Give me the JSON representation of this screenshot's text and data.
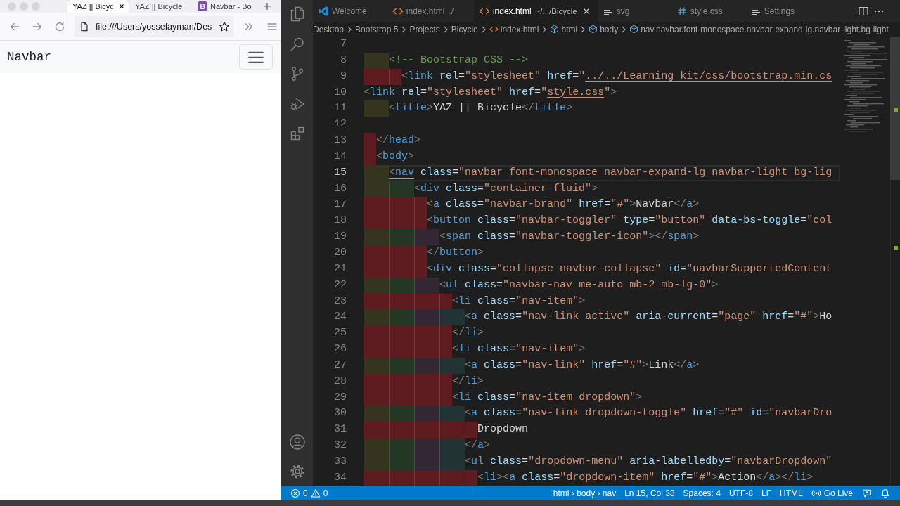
{
  "browser": {
    "tabs": [
      {
        "title": "YAZ || Bicyc",
        "selected": true
      },
      {
        "title": "YAZ || Bicycle",
        "selected": false
      },
      {
        "title": "Navbar - Bo",
        "favicon": "B",
        "selected": false
      }
    ],
    "address": "file:///Users/yossefayman/Des",
    "page": {
      "brand": "Navbar"
    }
  },
  "editor_tabs": [
    {
      "label": "Welcome",
      "kind": "welcome",
      "selected": false
    },
    {
      "label": "index.html",
      "description": "./",
      "kind": "html",
      "selected": false
    },
    {
      "label": "index.html",
      "description": "~/.../Bicycle",
      "kind": "html",
      "selected": true
    },
    {
      "label": "svg",
      "kind": "preview",
      "selected": false
    },
    {
      "label": "style.css",
      "kind": "css",
      "selected": false
    },
    {
      "label": "Settings",
      "kind": "preview",
      "selected": false
    }
  ],
  "breadcrumbs": [
    {
      "label": "Desktop",
      "kind": "folder"
    },
    {
      "label": "Bootstrap 5",
      "kind": "folder"
    },
    {
      "label": "Projects",
      "kind": "folder"
    },
    {
      "label": "Bicycle",
      "kind": "folder"
    },
    {
      "label": "index.html",
      "kind": "file"
    },
    {
      "label": "html",
      "kind": "element"
    },
    {
      "label": "body",
      "kind": "element"
    },
    {
      "label": "nav.navbar.font-monospace.navbar-expand-lg.navbar-light.bg-light",
      "kind": "element"
    }
  ],
  "editor": {
    "lines": [
      {
        "number": "7",
        "current": false
      },
      {
        "number": "8",
        "current": false,
        "indent_error": false,
        "code": [
          {
            "kind": "comment",
            "text": "    <!-- Bootstrap CSS -->"
          }
        ]
      },
      {
        "number": "9",
        "current": false,
        "indent_error": true,
        "code": [
          {
            "kind": "punct",
            "text": "      <"
          },
          {
            "kind": "tag",
            "text": "link"
          },
          {
            "kind": "attr",
            "text": " rel"
          },
          {
            "kind": "eq",
            "text": "="
          },
          {
            "kind": "str",
            "text": "\"stylesheet\""
          },
          {
            "kind": "attr",
            "text": " href"
          },
          {
            "kind": "eq",
            "text": "="
          },
          {
            "kind": "str",
            "text": "\""
          },
          {
            "kind": "link",
            "text": "../../Learning kit/css/bootstrap.min.cs"
          }
        ]
      },
      {
        "number": "10",
        "current": false,
        "code": [
          {
            "kind": "punct",
            "text": "<"
          },
          {
            "kind": "tag",
            "text": "link"
          },
          {
            "kind": "attr",
            "text": " rel"
          },
          {
            "kind": "eq",
            "text": "="
          },
          {
            "kind": "str",
            "text": "\"stylesheet\""
          },
          {
            "kind": "attr",
            "text": " href"
          },
          {
            "kind": "eq",
            "text": "="
          },
          {
            "kind": "str",
            "text": "\""
          },
          {
            "kind": "link",
            "text": "style.css"
          },
          {
            "kind": "str",
            "text": "\""
          },
          {
            "kind": "punct",
            "text": ">"
          }
        ]
      },
      {
        "number": "11",
        "current": false,
        "indent_error": false,
        "code": [
          {
            "kind": "punct",
            "text": "    <"
          },
          {
            "kind": "tag",
            "text": "title"
          },
          {
            "kind": "punct",
            "text": ">"
          },
          {
            "kind": "text",
            "text": "YAZ || Bicycle"
          },
          {
            "kind": "punct",
            "text": "</"
          },
          {
            "kind": "tag",
            "text": "title"
          },
          {
            "kind": "punct",
            "text": ">"
          }
        ]
      },
      {
        "number": "12",
        "current": false
      },
      {
        "number": "13",
        "current": false,
        "indent_error": true,
        "code": [
          {
            "kind": "punct",
            "text": "  </"
          },
          {
            "kind": "tag",
            "text": "head"
          },
          {
            "kind": "punct",
            "text": ">"
          }
        ]
      },
      {
        "number": "14",
        "current": false,
        "indent_error": true,
        "code": [
          {
            "kind": "punct",
            "text": "  <"
          },
          {
            "kind": "tag",
            "text": "body"
          },
          {
            "kind": "punct",
            "text": ">"
          }
        ]
      },
      {
        "number": "15",
        "current": true,
        "indent_error": false,
        "code": [
          {
            "kind": "matchpunct",
            "text": "    <"
          },
          {
            "kind": "matchtag",
            "text": "nav"
          },
          {
            "kind": "attr",
            "text": " class"
          },
          {
            "kind": "eq",
            "text": "="
          },
          {
            "kind": "str",
            "text": "\"navbar font-monospace navbar-expand-lg navbar-light bg-lig"
          }
        ]
      },
      {
        "number": "16",
        "current": false,
        "indent_error": false,
        "code": [
          {
            "kind": "punct",
            "text": "        <"
          },
          {
            "kind": "tag",
            "text": "div"
          },
          {
            "kind": "attr",
            "text": " class"
          },
          {
            "kind": "eq",
            "text": "="
          },
          {
            "kind": "str",
            "text": "\"container-fluid\""
          },
          {
            "kind": "punct",
            "text": ">"
          }
        ]
      },
      {
        "number": "17",
        "current": false,
        "indent_error": true,
        "code": [
          {
            "kind": "punct",
            "text": "          <"
          },
          {
            "kind": "tag",
            "text": "a"
          },
          {
            "kind": "attr",
            "text": " class"
          },
          {
            "kind": "eq",
            "text": "="
          },
          {
            "kind": "str",
            "text": "\"navbar-brand\""
          },
          {
            "kind": "attr",
            "text": " href"
          },
          {
            "kind": "eq",
            "text": "="
          },
          {
            "kind": "str",
            "text": "\"#\""
          },
          {
            "kind": "punct",
            "text": ">"
          },
          {
            "kind": "text",
            "text": "Navbar"
          },
          {
            "kind": "punct",
            "text": "</"
          },
          {
            "kind": "tag",
            "text": "a"
          },
          {
            "kind": "punct",
            "text": ">"
          }
        ]
      },
      {
        "number": "18",
        "current": false,
        "indent_error": true,
        "code": [
          {
            "kind": "punct",
            "text": "          <"
          },
          {
            "kind": "tag",
            "text": "button"
          },
          {
            "kind": "attr",
            "text": " class"
          },
          {
            "kind": "eq",
            "text": "="
          },
          {
            "kind": "str",
            "text": "\"navbar-toggler\""
          },
          {
            "kind": "attr",
            "text": " type"
          },
          {
            "kind": "eq",
            "text": "="
          },
          {
            "kind": "str",
            "text": "\"button\""
          },
          {
            "kind": "attr",
            "text": " data-bs-toggle"
          },
          {
            "kind": "eq",
            "text": "="
          },
          {
            "kind": "str",
            "text": "\"col"
          }
        ]
      },
      {
        "number": "19",
        "current": false,
        "indent_error": false,
        "code": [
          {
            "kind": "punct",
            "text": "            <"
          },
          {
            "kind": "tag",
            "text": "span"
          },
          {
            "kind": "attr",
            "text": " class"
          },
          {
            "kind": "eq",
            "text": "="
          },
          {
            "kind": "str",
            "text": "\"navbar-toggler-icon\""
          },
          {
            "kind": "punct",
            "text": "></"
          },
          {
            "kind": "tag",
            "text": "span"
          },
          {
            "kind": "punct",
            "text": ">"
          }
        ]
      },
      {
        "number": "20",
        "current": false,
        "indent_error": true,
        "code": [
          {
            "kind": "punct",
            "text": "          </"
          },
          {
            "kind": "tag",
            "text": "button"
          },
          {
            "kind": "punct",
            "text": ">"
          }
        ]
      },
      {
        "number": "21",
        "current": false,
        "indent_error": true,
        "code": [
          {
            "kind": "punct",
            "text": "          <"
          },
          {
            "kind": "tag",
            "text": "div"
          },
          {
            "kind": "attr",
            "text": " class"
          },
          {
            "kind": "eq",
            "text": "="
          },
          {
            "kind": "str",
            "text": "\"collapse navbar-collapse\""
          },
          {
            "kind": "attr",
            "text": " id"
          },
          {
            "kind": "eq",
            "text": "="
          },
          {
            "kind": "str",
            "text": "\"navbarSupportedContent"
          }
        ]
      },
      {
        "number": "22",
        "current": false,
        "indent_error": false,
        "code": [
          {
            "kind": "punct",
            "text": "            <"
          },
          {
            "kind": "tag",
            "text": "ul"
          },
          {
            "kind": "attr",
            "text": " class"
          },
          {
            "kind": "eq",
            "text": "="
          },
          {
            "kind": "str",
            "text": "\"navbar-nav me-auto mb-2 mb-lg-0\""
          },
          {
            "kind": "punct",
            "text": ">"
          }
        ]
      },
      {
        "number": "23",
        "current": false,
        "indent_error": true,
        "code": [
          {
            "kind": "punct",
            "text": "              <"
          },
          {
            "kind": "tag",
            "text": "li"
          },
          {
            "kind": "attr",
            "text": " class"
          },
          {
            "kind": "eq",
            "text": "="
          },
          {
            "kind": "str",
            "text": "\"nav-item\""
          },
          {
            "kind": "punct",
            "text": ">"
          }
        ]
      },
      {
        "number": "24",
        "current": false,
        "indent_error": false,
        "code": [
          {
            "kind": "punct",
            "text": "                <"
          },
          {
            "kind": "tag",
            "text": "a"
          },
          {
            "kind": "attr",
            "text": " class"
          },
          {
            "kind": "eq",
            "text": "="
          },
          {
            "kind": "str",
            "text": "\"nav-link active\""
          },
          {
            "kind": "attr",
            "text": " aria-current"
          },
          {
            "kind": "eq",
            "text": "="
          },
          {
            "kind": "str",
            "text": "\"page\""
          },
          {
            "kind": "attr",
            "text": " href"
          },
          {
            "kind": "eq",
            "text": "="
          },
          {
            "kind": "str",
            "text": "\"#\""
          },
          {
            "kind": "punct",
            "text": ">"
          },
          {
            "kind": "text",
            "text": "Ho"
          }
        ]
      },
      {
        "number": "25",
        "current": false,
        "indent_error": true,
        "code": [
          {
            "kind": "punct",
            "text": "              </"
          },
          {
            "kind": "tag",
            "text": "li"
          },
          {
            "kind": "punct",
            "text": ">"
          }
        ]
      },
      {
        "number": "26",
        "current": false,
        "indent_error": true,
        "code": [
          {
            "kind": "punct",
            "text": "              <"
          },
          {
            "kind": "tag",
            "text": "li"
          },
          {
            "kind": "attr",
            "text": " class"
          },
          {
            "kind": "eq",
            "text": "="
          },
          {
            "kind": "str",
            "text": "\"nav-item\""
          },
          {
            "kind": "punct",
            "text": ">"
          }
        ]
      },
      {
        "number": "27",
        "current": false,
        "indent_error": false,
        "code": [
          {
            "kind": "punct",
            "text": "                <"
          },
          {
            "kind": "tag",
            "text": "a"
          },
          {
            "kind": "attr",
            "text": " class"
          },
          {
            "kind": "eq",
            "text": "="
          },
          {
            "kind": "str",
            "text": "\"nav-link\""
          },
          {
            "kind": "attr",
            "text": " href"
          },
          {
            "kind": "eq",
            "text": "="
          },
          {
            "kind": "str",
            "text": "\"#\""
          },
          {
            "kind": "punct",
            "text": ">"
          },
          {
            "kind": "text",
            "text": "Link"
          },
          {
            "kind": "punct",
            "text": "</"
          },
          {
            "kind": "tag",
            "text": "a"
          },
          {
            "kind": "punct",
            "text": ">"
          }
        ]
      },
      {
        "number": "28",
        "current": false,
        "indent_error": true,
        "code": [
          {
            "kind": "punct",
            "text": "              </"
          },
          {
            "kind": "tag",
            "text": "li"
          },
          {
            "kind": "punct",
            "text": ">"
          }
        ]
      },
      {
        "number": "29",
        "current": false,
        "indent_error": true,
        "code": [
          {
            "kind": "punct",
            "text": "              <"
          },
          {
            "kind": "tag",
            "text": "li"
          },
          {
            "kind": "attr",
            "text": " class"
          },
          {
            "kind": "eq",
            "text": "="
          },
          {
            "kind": "str",
            "text": "\"nav-item dropdown\""
          },
          {
            "kind": "punct",
            "text": ">"
          }
        ]
      },
      {
        "number": "30",
        "current": false,
        "indent_error": false,
        "code": [
          {
            "kind": "punct",
            "text": "                <"
          },
          {
            "kind": "tag",
            "text": "a"
          },
          {
            "kind": "attr",
            "text": " class"
          },
          {
            "kind": "eq",
            "text": "="
          },
          {
            "kind": "str",
            "text": "\"nav-link dropdown-toggle\""
          },
          {
            "kind": "attr",
            "text": " href"
          },
          {
            "kind": "eq",
            "text": "="
          },
          {
            "kind": "str",
            "text": "\"#\""
          },
          {
            "kind": "attr",
            "text": " id"
          },
          {
            "kind": "eq",
            "text": "="
          },
          {
            "kind": "str",
            "text": "\"navbarDro"
          }
        ]
      },
      {
        "number": "31",
        "current": false,
        "indent_error": true,
        "code": [
          {
            "kind": "text",
            "text": "                  Dropdown"
          }
        ]
      },
      {
        "number": "32",
        "current": false,
        "indent_error": false,
        "code": [
          {
            "kind": "punct",
            "text": "                </"
          },
          {
            "kind": "tag",
            "text": "a"
          },
          {
            "kind": "punct",
            "text": ">"
          }
        ]
      },
      {
        "number": "33",
        "current": false,
        "indent_error": false,
        "code": [
          {
            "kind": "punct",
            "text": "                <"
          },
          {
            "kind": "tag",
            "text": "ul"
          },
          {
            "kind": "attr",
            "text": " class"
          },
          {
            "kind": "eq",
            "text": "="
          },
          {
            "kind": "str",
            "text": "\"dropdown-menu\""
          },
          {
            "kind": "attr",
            "text": " aria-labelledby"
          },
          {
            "kind": "eq",
            "text": "="
          },
          {
            "kind": "str",
            "text": "\"navbarDropdown\""
          }
        ]
      },
      {
        "number": "34",
        "current": false,
        "indent_error": true,
        "code": [
          {
            "kind": "punct",
            "text": "                  <"
          },
          {
            "kind": "tag",
            "text": "li"
          },
          {
            "kind": "punct",
            "text": "><"
          },
          {
            "kind": "tag",
            "text": "a"
          },
          {
            "kind": "attr",
            "text": " class"
          },
          {
            "kind": "eq",
            "text": "="
          },
          {
            "kind": "str",
            "text": "\"dropdown-item\""
          },
          {
            "kind": "attr",
            "text": " href"
          },
          {
            "kind": "eq",
            "text": "="
          },
          {
            "kind": "str",
            "text": "\"#\""
          },
          {
            "kind": "punct",
            "text": ">"
          },
          {
            "kind": "text",
            "text": "Action"
          },
          {
            "kind": "punct",
            "text": "</"
          },
          {
            "kind": "tag",
            "text": "a"
          },
          {
            "kind": "punct",
            "text": "></"
          },
          {
            "kind": "tag",
            "text": "li"
          },
          {
            "kind": "punct",
            "text": ">"
          }
        ]
      }
    ]
  },
  "status_bar": {
    "problems": {
      "errors": "0",
      "warnings": "0"
    },
    "items": [
      "html › body › nav",
      "Ln 15, Col 38",
      "Spaces: 4",
      "UTF-8",
      "LF",
      "HTML"
    ],
    "go_live": "Go Live"
  }
}
